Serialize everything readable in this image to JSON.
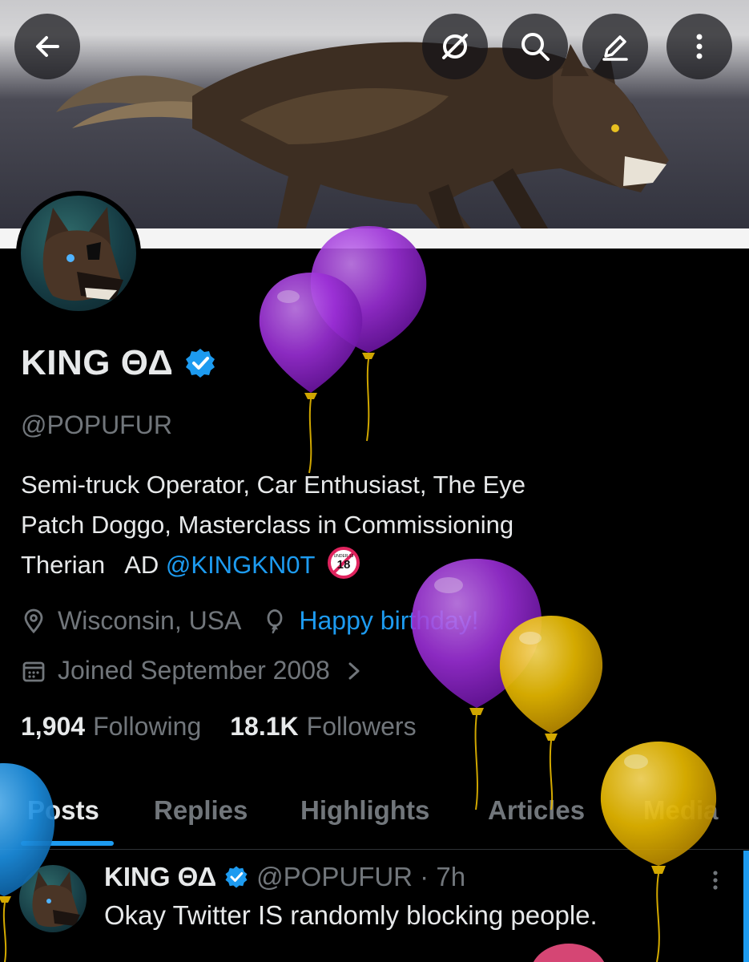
{
  "header": {
    "back_icon": "arrow-left-icon",
    "grok_icon": "slashed-circle-icon",
    "search_icon": "search-icon",
    "edit_icon": "pencil-icon",
    "more_icon": "more-vertical-icon"
  },
  "profile": {
    "display_name": "KING ΘΔ",
    "handle": "@POPUFUR",
    "bio_line1": "Semi-truck Operator, Car Enthusiast, The Eye",
    "bio_line2": "Patch Doggo, Masterclass in Commissioning",
    "bio_line3_prefix": "Therian   AD ",
    "bio_mention": "@KINGKN0T",
    "no18_badge": "UNDER 18",
    "location": "Wisconsin, USA",
    "birthday": "Happy birthday!",
    "joined": "Joined September 2008",
    "following_count": "1,904",
    "following_label": "Following",
    "followers_count": "18.1K",
    "followers_label": "Followers"
  },
  "tabs": [
    {
      "label": "Posts",
      "active": true
    },
    {
      "label": "Replies"
    },
    {
      "label": "Highlights"
    },
    {
      "label": "Articles"
    },
    {
      "label": "Media"
    }
  ],
  "post": {
    "name": "KING ΘΔ",
    "handle_time": "@POPUFUR · 7h",
    "text": "Okay Twitter IS randomly blocking people."
  },
  "colors": {
    "accent": "#1d9bf0",
    "text": "#e7e9ea",
    "muted": "#71767b",
    "balloon_purple": "#9b2fd6",
    "balloon_yellow": "#e6b800"
  }
}
